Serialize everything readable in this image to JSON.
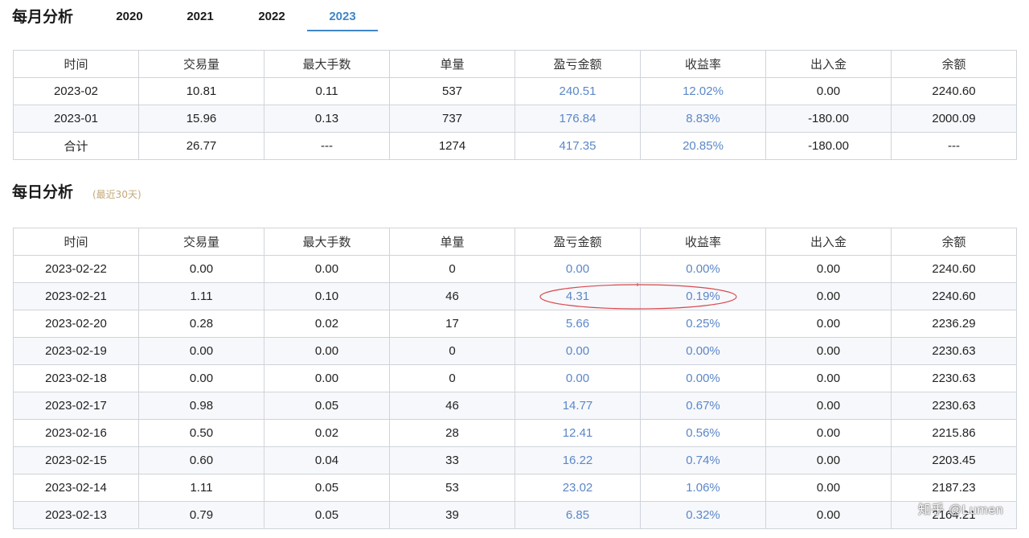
{
  "monthly": {
    "title": "每月分析",
    "year_tabs": [
      "2020",
      "2021",
      "2022",
      "2023"
    ],
    "active_year": "2023",
    "headers": [
      "时间",
      "交易量",
      "最大手数",
      "单量",
      "盈亏金额",
      "收益率",
      "出入金",
      "余额"
    ],
    "rows": [
      [
        "2023-02",
        "10.81",
        "0.11",
        "537",
        "240.51",
        "12.02%",
        "0.00",
        "2240.60"
      ],
      [
        "2023-01",
        "15.96",
        "0.13",
        "737",
        "176.84",
        "8.83%",
        "-180.00",
        "2000.09"
      ],
      [
        "合计",
        "26.77",
        "---",
        "1274",
        "417.35",
        "20.85%",
        "-180.00",
        "---"
      ]
    ]
  },
  "daily": {
    "title": "每日分析",
    "subtitle": "(最近30天)",
    "headers": [
      "时间",
      "交易量",
      "最大手数",
      "单量",
      "盈亏金额",
      "收益率",
      "出入金",
      "余额"
    ],
    "rows": [
      [
        "2023-02-22",
        "0.00",
        "0.00",
        "0",
        "0.00",
        "0.00%",
        "0.00",
        "2240.60"
      ],
      [
        "2023-02-21",
        "1.11",
        "0.10",
        "46",
        "4.31",
        "0.19%",
        "0.00",
        "2240.60"
      ],
      [
        "2023-02-20",
        "0.28",
        "0.02",
        "17",
        "5.66",
        "0.25%",
        "0.00",
        "2236.29"
      ],
      [
        "2023-02-19",
        "0.00",
        "0.00",
        "0",
        "0.00",
        "0.00%",
        "0.00",
        "2230.63"
      ],
      [
        "2023-02-18",
        "0.00",
        "0.00",
        "0",
        "0.00",
        "0.00%",
        "0.00",
        "2230.63"
      ],
      [
        "2023-02-17",
        "0.98",
        "0.05",
        "46",
        "14.77",
        "0.67%",
        "0.00",
        "2230.63"
      ],
      [
        "2023-02-16",
        "0.50",
        "0.02",
        "28",
        "12.41",
        "0.56%",
        "0.00",
        "2215.86"
      ],
      [
        "2023-02-15",
        "0.60",
        "0.04",
        "33",
        "16.22",
        "0.74%",
        "0.00",
        "2203.45"
      ],
      [
        "2023-02-14",
        "1.11",
        "0.05",
        "53",
        "23.02",
        "1.06%",
        "0.00",
        "2187.23"
      ],
      [
        "2023-02-13",
        "0.79",
        "0.05",
        "39",
        "6.85",
        "0.32%",
        "0.00",
        "2164.21"
      ]
    ]
  },
  "annotation": {
    "highlighted_row": "2023-02-21",
    "color": "#d9484f"
  },
  "colors": {
    "accent": "#3f86c7",
    "value_blue": "#5b87c8",
    "subtitle_gold": "#c4a878"
  },
  "watermark": "知乎 @Lumen"
}
